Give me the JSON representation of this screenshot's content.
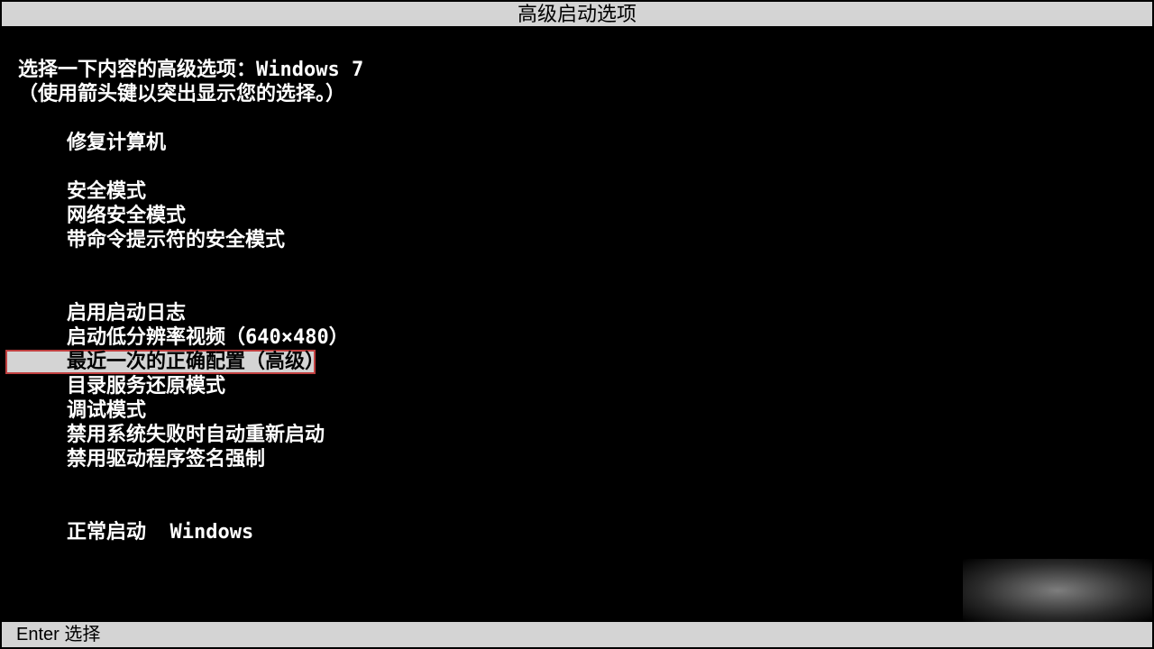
{
  "title": "高级启动选项",
  "header_line1": "选择一下内容的高级选项：Windows 7",
  "header_line2": "（使用箭头键以突出显示您的选择。）",
  "groups": {
    "g0": {
      "i0": "修复计算机"
    },
    "g1": {
      "i0": "安全模式",
      "i1": "网络安全模式",
      "i2": "带命令提示符的安全模式"
    },
    "g2": {
      "i0": "启用启动日志",
      "i1": "启动低分辨率视频（640×480）",
      "i2": "最近一次的正确配置（高级）",
      "i3": "目录服务还原模式",
      "i4": "调试模式",
      "i5": "禁用系统失败时自动重新启动",
      "i6": "禁用驱动程序签名强制"
    },
    "g3": {
      "i0": "正常启动  Windows"
    }
  },
  "footer": "Enter 选择"
}
